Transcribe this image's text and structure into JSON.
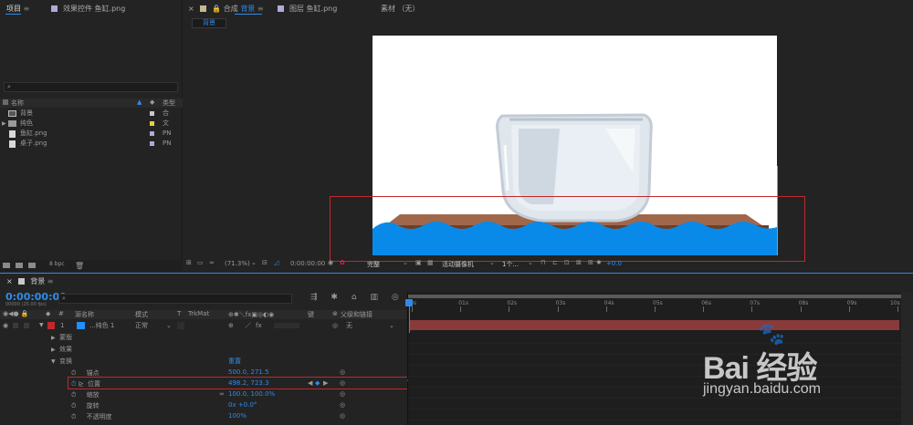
{
  "project": {
    "tab_label": "项目",
    "effects_tab": "效果控件 鱼缸.png",
    "search_icon": "search-icon",
    "col_name": "名称",
    "col_type": "类型",
    "items": [
      {
        "name": "背景",
        "type": "合",
        "color": "#c8c8c8",
        "icon": "composition-icon"
      },
      {
        "name": "纯色",
        "type": "文",
        "color": "#e8d040",
        "icon": "folder-icon"
      },
      {
        "name": "鱼缸.png",
        "type": "PN",
        "color": "#b4a8d8",
        "icon": "image-icon"
      },
      {
        "name": "桌子.png",
        "type": "PN",
        "color": "#b4a8d8",
        "icon": "image-icon"
      }
    ],
    "bpc": "8 bpc"
  },
  "composition": {
    "tab_label": "合成",
    "tab_name": "背景",
    "layer_tab": "图层 鱼缸.png",
    "footage_tab": "素材 （无）",
    "breadcrumb": "背景",
    "zoom": "(71.3%)",
    "timecode": "0:00:00:00",
    "quality": "完整",
    "camera": "活动摄像机",
    "views": "1个...",
    "exposure": "+0.0"
  },
  "timeline": {
    "tab_label": "背景",
    "timecode": "0:00:00:00",
    "frame_info": "00000 (25.00 fps)",
    "col_source": "源名称",
    "col_mode": "模式",
    "col_t": "T",
    "col_trkmat": "TrkMat",
    "col_keys": "键",
    "col_parent": "父级和链接",
    "layer": {
      "number": "1",
      "name": "...纯色 1",
      "mode": "正常",
      "parent": "无"
    },
    "sections": {
      "mask": "蒙版",
      "effects": "效果",
      "transform": "变换",
      "reset": "重置"
    },
    "properties": [
      {
        "label": "锚点",
        "value": "500.0, 271.5"
      },
      {
        "label": "位置",
        "value": "498.2, 723.3"
      },
      {
        "label": "缩放",
        "value": "100.0, 100.0%"
      },
      {
        "label": "旋转",
        "value": "0x +0.0°"
      },
      {
        "label": "不透明度",
        "value": "100%"
      }
    ],
    "ruler": [
      "0s",
      "01s",
      "02s",
      "03s",
      "04s",
      "05s",
      "06s",
      "07s",
      "08s",
      "09s",
      "10s"
    ]
  },
  "colors": {
    "accent": "#2d8ceb",
    "highlight": "#c0282d",
    "water": "#0a8ae8",
    "layer_bar": "#8a3a3a"
  },
  "watermark": {
    "brand": "Bai 经验",
    "url": "jingyan.baidu.com"
  }
}
